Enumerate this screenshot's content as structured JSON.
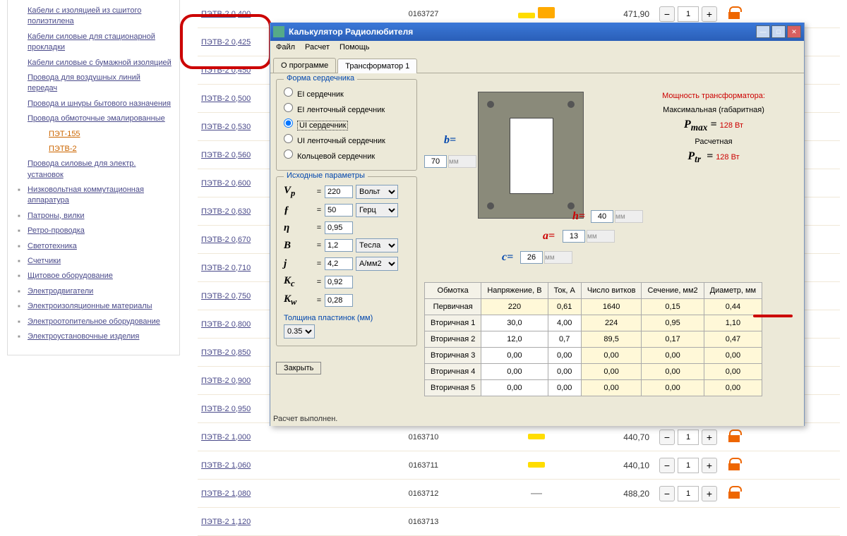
{
  "sidebar": {
    "items": [
      {
        "label": "Кабели с изоляцией из сшитого полиэтилена",
        "cls": ""
      },
      {
        "label": "Кабели силовые для стационарной прокладки",
        "cls": ""
      },
      {
        "label": "Кабели силовые с бумажной изоляцией",
        "cls": ""
      },
      {
        "label": "Провода для воздушных линий передач",
        "cls": ""
      },
      {
        "label": "Провода и шнуры бытового назначения",
        "cls": ""
      },
      {
        "label": "Провода обмоточные эмалированные",
        "cls": ""
      },
      {
        "label": "ПЭТ-155",
        "cls": "sub"
      },
      {
        "label": "ПЭТВ-2",
        "cls": "sub"
      },
      {
        "label": "Провода силовые для электр. установок",
        "cls": ""
      },
      {
        "label": "Низковольтная коммутационная аппаратура",
        "cls": "bul"
      },
      {
        "label": "Патроны, вилки",
        "cls": "bul"
      },
      {
        "label": "Ретро-проводка",
        "cls": "bul"
      },
      {
        "label": "Светотехника",
        "cls": "bul"
      },
      {
        "label": "Счетчики",
        "cls": "bul"
      },
      {
        "label": "Щитовое оборудование",
        "cls": "bul"
      },
      {
        "label": "Электродвигатели",
        "cls": "bul"
      },
      {
        "label": "Электроизоляционные материалы",
        "cls": "bul"
      },
      {
        "label": "Электроотопительное оборудование",
        "cls": "bul"
      },
      {
        "label": "Электроустановочные изделия",
        "cls": "bul"
      }
    ]
  },
  "products": [
    {
      "name": "ПЭТВ-2 0,400",
      "code": "0163727",
      "stock": "bar truck",
      "price": "471,90",
      "qty": "1"
    },
    {
      "name": "ПЭТВ-2 0,425",
      "code": "",
      "stock": "",
      "price": "",
      "qty": ""
    },
    {
      "name": "ПЭТВ-2 0,450",
      "code": "",
      "stock": "",
      "price": "",
      "qty": ""
    },
    {
      "name": "ПЭТВ-2 0,500",
      "code": "",
      "stock": "",
      "price": "",
      "qty": ""
    },
    {
      "name": "ПЭТВ-2 0,530",
      "code": "",
      "stock": "",
      "price": "",
      "qty": ""
    },
    {
      "name": "ПЭТВ-2 0,560",
      "code": "",
      "stock": "",
      "price": "",
      "qty": ""
    },
    {
      "name": "ПЭТВ-2 0,600",
      "code": "",
      "stock": "",
      "price": "",
      "qty": ""
    },
    {
      "name": "ПЭТВ-2 0,630",
      "code": "",
      "stock": "",
      "price": "",
      "qty": ""
    },
    {
      "name": "ПЭТВ-2 0,670",
      "code": "",
      "stock": "",
      "price": "",
      "qty": ""
    },
    {
      "name": "ПЭТВ-2 0,710",
      "code": "",
      "stock": "",
      "price": "",
      "qty": ""
    },
    {
      "name": "ПЭТВ-2 0,750",
      "code": "",
      "stock": "",
      "price": "",
      "qty": ""
    },
    {
      "name": "ПЭТВ-2 0,800",
      "code": "",
      "stock": "",
      "price": "",
      "qty": ""
    },
    {
      "name": "ПЭТВ-2 0,850",
      "code": "",
      "stock": "",
      "price": "",
      "qty": ""
    },
    {
      "name": "ПЭТВ-2 0,900",
      "code": "",
      "stock": "",
      "price": "",
      "qty": ""
    },
    {
      "name": "ПЭТВ-2 0,950",
      "code": "",
      "stock": "",
      "price": "",
      "qty": ""
    },
    {
      "name": "ПЭТВ-2 1,000",
      "code": "0163710",
      "stock": "bar",
      "price": "440,70",
      "qty": "1"
    },
    {
      "name": "ПЭТВ-2 1,060",
      "code": "0163711",
      "stock": "bar",
      "price": "440,10",
      "qty": "1"
    },
    {
      "name": "ПЭТВ-2 1,080",
      "code": "0163712",
      "stock": "dash",
      "price": "488,20",
      "qty": "1"
    },
    {
      "name": "ПЭТВ-2 1,120",
      "code": "0163713",
      "stock": "",
      "price": "",
      "qty": ""
    }
  ],
  "win": {
    "title": "Калькулятор Радиолюбителя",
    "menu": {
      "file": "Файл",
      "calc": "Расчет",
      "help": "Помощь"
    },
    "tabs": {
      "about": "О программе",
      "t1": "Трансформатор 1"
    },
    "coreTitle": "Форма сердечника",
    "cores": [
      "EI сердечник",
      "EI ленточный сердечник",
      "UI сердечник",
      "UI ленточный сердечник",
      "Кольцевой сердечник"
    ],
    "paramsTitle": "Исходные параметры",
    "params": {
      "Vp": {
        "sym": "V<sub>p</sub>",
        "val": "220",
        "unit": "Вольт"
      },
      "f": {
        "sym": "ƒ",
        "val": "50",
        "unit": "Герц"
      },
      "eta": {
        "sym": "η",
        "val": "0,95",
        "unit": ""
      },
      "B": {
        "sym": "B",
        "val": "1,2",
        "unit": "Тесла"
      },
      "j": {
        "sym": "j",
        "val": "4,2",
        "unit": "А/мм2"
      },
      "Kc": {
        "sym": "K<sub>c</sub>",
        "val": "0,92",
        "unit": ""
      },
      "Kw": {
        "sym": "K<sub>w</sub>",
        "val": "0,28",
        "unit": ""
      }
    },
    "thickLabel": "Толщина пластинок (мм)",
    "thickVal": "0.35",
    "closeBtn": "Закрыть",
    "dims": {
      "b": "70",
      "c": "26",
      "a": "13",
      "h": "40",
      "unit": "мм"
    },
    "power": {
      "title": "Мощность трансформатора:",
      "maxLabel": "Максимальная (габаритная)",
      "maxSym": "P<sub>max</sub> =",
      "maxVal": "128 Вт",
      "calcLabel": "Расчетная",
      "calcSym": "P<sub>tr</sub>  =",
      "calcVal": "128 Вт"
    },
    "table": {
      "headers": [
        "Обмотка",
        "Напряжение, В",
        "Ток, А",
        "Число витков",
        "Сечение, мм2",
        "Диаметр, мм"
      ],
      "rows": [
        {
          "lab": "Первичная",
          "v": "220",
          "i": "0,61",
          "n": "1640",
          "s": "0,15",
          "d": "0,44",
          "prim": true
        },
        {
          "lab": "Вторичная 1",
          "v": "30,0",
          "i": "4,00",
          "n": "224",
          "s": "0,95",
          "d": "1,10"
        },
        {
          "lab": "Вторичная 2",
          "v": "12,0",
          "i": "0,7",
          "n": "89,5",
          "s": "0,17",
          "d": "0,47"
        },
        {
          "lab": "Вторичная 3",
          "v": "0,00",
          "i": "0,00",
          "n": "0,00",
          "s": "0,00",
          "d": "0,00"
        },
        {
          "lab": "Вторичная 4",
          "v": "0,00",
          "i": "0,00",
          "n": "0,00",
          "s": "0,00",
          "d": "0,00"
        },
        {
          "lab": "Вторичная 5",
          "v": "0,00",
          "i": "0,00",
          "n": "0,00",
          "s": "0,00",
          "d": "0,00"
        }
      ]
    },
    "status": "Расчет выполнен."
  }
}
